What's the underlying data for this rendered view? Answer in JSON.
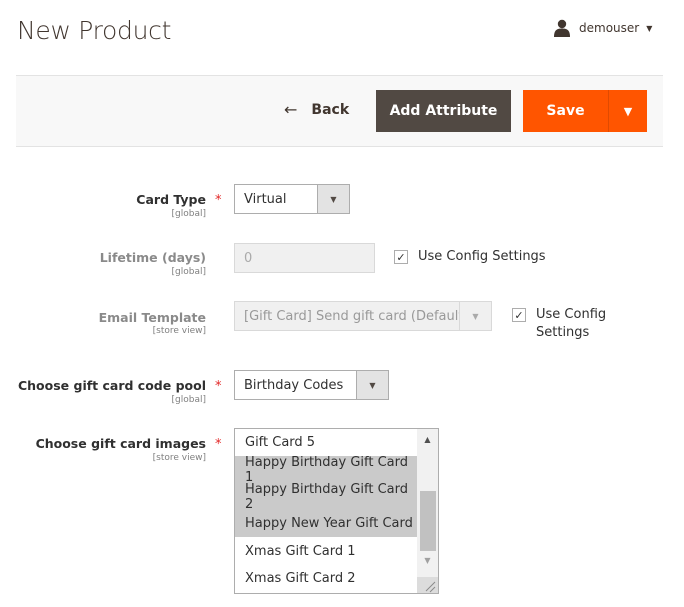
{
  "header": {
    "title": "New Product",
    "user": "demouser"
  },
  "toolbar": {
    "back_label": "Back",
    "add_attribute_label": "Add Attribute",
    "save_label": "Save"
  },
  "form": {
    "card_type": {
      "label": "Card Type",
      "scope": "[global]",
      "required": true,
      "value": "Virtual"
    },
    "lifetime": {
      "label": "Lifetime (days)",
      "scope": "[global]",
      "value": "0",
      "use_config_label": "Use Config Settings",
      "use_config_checked": true
    },
    "email_template": {
      "label": "Email Template",
      "scope": "[store view]",
      "value": "[Gift Card] Send gift card (Default)",
      "use_config_label_line1": "Use Config",
      "use_config_label_line2": "Settings",
      "use_config_checked": true
    },
    "code_pool": {
      "label": "Choose gift card code pool",
      "scope": "[global]",
      "required": true,
      "value": "Birthday Codes"
    },
    "images": {
      "label": "Choose gift card images",
      "scope": "[store view]",
      "required": true,
      "options": [
        {
          "label": "Gift Card 5",
          "selected": false
        },
        {
          "label": "Happy Birthday Gift Card 1",
          "selected": true
        },
        {
          "label": "Happy Birthday Gift Card 2",
          "selected": true
        },
        {
          "label": "Happy New Year Gift Card",
          "selected": true
        },
        {
          "label": "Xmas Gift Card 1",
          "selected": false
        },
        {
          "label": "Xmas Gift Card 2",
          "selected": false
        }
      ]
    }
  },
  "icons": {
    "required_mark": "*",
    "check": "✓",
    "caret_down": "▼",
    "arrow_up": "▲",
    "back_arrow": "←"
  }
}
